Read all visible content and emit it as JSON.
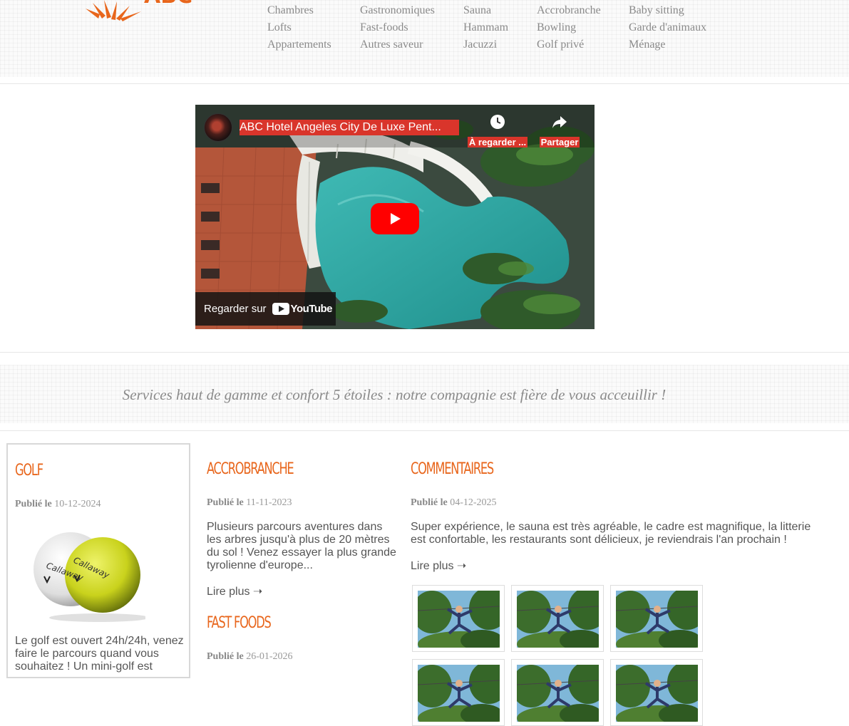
{
  "header": {
    "logo_text": "ABC",
    "menu": [
      [
        "Chambres",
        "Lofts",
        "Appartements"
      ],
      [
        "Gastronomiques",
        "Fast-foods",
        "Autres saveur"
      ],
      [
        "Sauna",
        "Hammam",
        "Jacuzzi"
      ],
      [
        "Accrobranche",
        "Bowling",
        "Golf privé"
      ],
      [
        "Baby sitting",
        "Garde d'animaux",
        "Ménage"
      ]
    ]
  },
  "video": {
    "title": "ABC Hotel Angeles City De Luxe Pent...",
    "watch_later": "À regarder ...",
    "share": "Partager",
    "watch_on": "Regarder sur",
    "platform": "YouTube",
    "play_color": "#ff0000"
  },
  "slogan": "Services haut de gamme et confort 5 étoiles : notre compagnie est fière de vous acceuillir !",
  "articles": {
    "golf": {
      "title": "GOLF",
      "published_label": "Publié le",
      "date": "10-12-2024",
      "text": "Le golf est ouvert 24h/24h, venez faire le parcours quand vous souhaitez ! Un mini-golf est",
      "ball_brand": "Callaway"
    },
    "accrobranche": {
      "title": "ACCROBRANCHE",
      "published_label": "Publié le",
      "date": "11-11-2023",
      "text": "Plusieurs parcours aventures dans les arbres jusqu'à plus de 20 mètres du sol ! Venez essayer la plus grande tyrolienne d'europe...",
      "read_more": "Lire plus ➝"
    },
    "fastfoods": {
      "title": "FAST FOODS",
      "published_label": "Publié le",
      "date": "26-01-2026"
    },
    "commentaires": {
      "title": "COMMENTAIRES",
      "published_label": "Publié le",
      "date": "04-12-2025",
      "text": "Super expérience, le sauna est très agréable, le cadre est magnifique, la litterie est confortable, les restaurants sont délicieux, je reviendrais l'an prochain !",
      "read_more": "Lire plus ➝"
    }
  },
  "colors": {
    "accent": "#e8661c",
    "menu_text": "#8a8a8a"
  }
}
